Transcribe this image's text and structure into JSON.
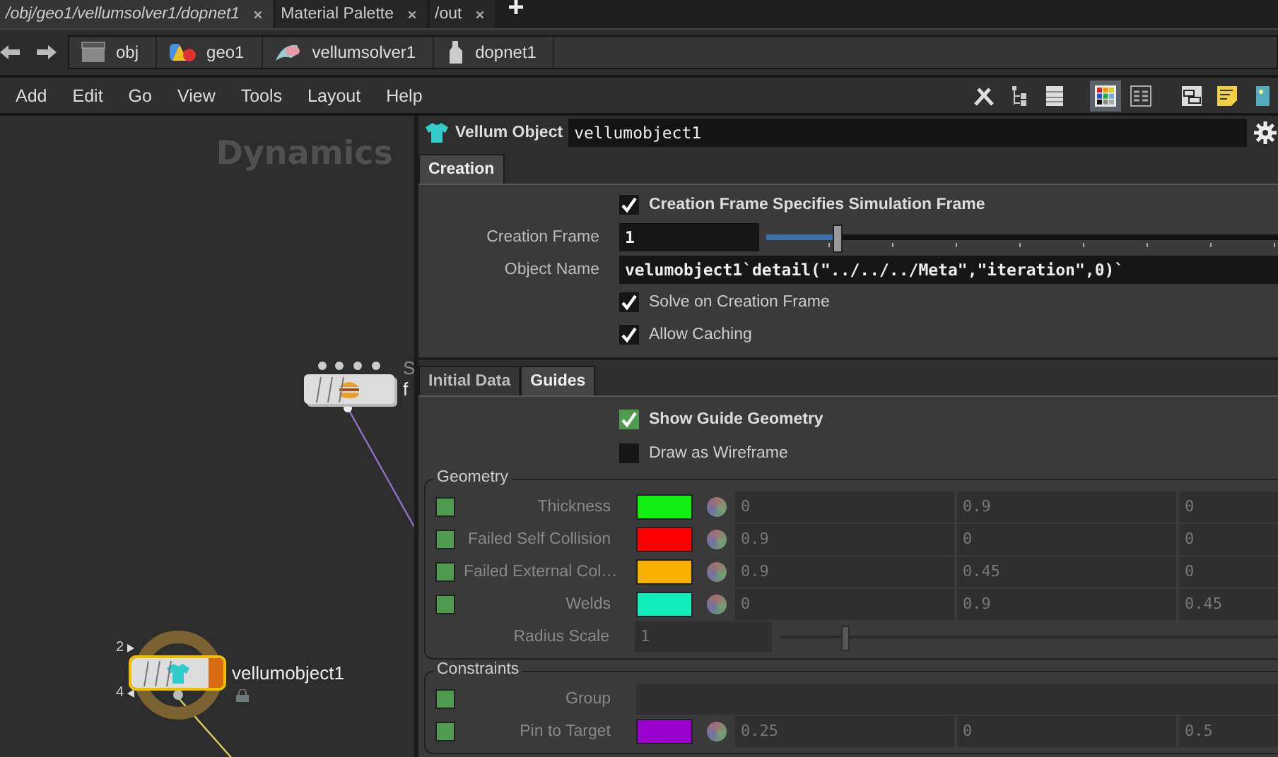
{
  "path_tabs": [
    {
      "label": "/obj/geo1/vellumsolver1/dopnet1",
      "selected": true
    },
    {
      "label": "Material Palette",
      "selected": false
    },
    {
      "label": "/out",
      "selected": false
    }
  ],
  "breadcrumbs": [
    {
      "label": "obj",
      "kind": "obj"
    },
    {
      "label": "geo1",
      "kind": "geo"
    },
    {
      "label": "vellumsolver1",
      "kind": "solver"
    },
    {
      "label": "dopnet1",
      "kind": "dopnet"
    }
  ],
  "menu": [
    "Add",
    "Edit",
    "Go",
    "View",
    "Tools",
    "Layout",
    "Help"
  ],
  "toolbar": [
    {
      "kind": "wrench",
      "selected": false
    },
    {
      "kind": "tree",
      "selected": false
    },
    {
      "kind": "list",
      "selected": false
    },
    {
      "kind": "palette",
      "selected": true
    },
    {
      "kind": "grid",
      "selected": false
    },
    {
      "kind": "boxes",
      "selected": false
    },
    {
      "kind": "note",
      "selected": false
    },
    {
      "kind": "image",
      "selected": false
    }
  ],
  "network": {
    "context_label": "Dynamics",
    "nodes": [
      {
        "kind": "force",
        "comment": "S",
        "label": "f",
        "selected": false,
        "locked": false
      },
      {
        "kind": "vellum",
        "label": "vellumobject1",
        "selected": true,
        "locked": true,
        "input_count": "2",
        "output_count": "4"
      }
    ]
  },
  "params": {
    "type_label": "Vellum Object",
    "name": "vellumobject1",
    "top_tabs": [
      {
        "label": "Creation",
        "selected": true
      }
    ],
    "creation": [
      {
        "kind": "toggle",
        "label": "Creation Frame Specifies Simulation Frame",
        "checked": true,
        "modified": true
      },
      {
        "kind": "slider",
        "label": "Creation Frame",
        "value": "1",
        "level": 0.13
      },
      {
        "kind": "text",
        "label": "Object Name",
        "value": "velumobject1`detail(\"../../../Meta\",\"iteration\",0)`"
      },
      {
        "kind": "toggle",
        "label": "Solve on Creation Frame",
        "checked": true,
        "modified": false
      },
      {
        "kind": "toggle",
        "label": "Allow Caching",
        "checked": true,
        "modified": false
      }
    ],
    "sub_tabs": [
      {
        "label": "Initial Data",
        "selected": false
      },
      {
        "label": "Guides",
        "selected": true
      }
    ],
    "guides": [
      {
        "label": "Show Guide Geometry",
        "checked": true,
        "modified": true
      },
      {
        "label": "Draw as Wireframe",
        "checked": false,
        "modified": false
      }
    ],
    "groups": [
      {
        "title": "Geometry",
        "rows": [
          {
            "kind": "color",
            "label": "Thickness",
            "enabled": true,
            "color": "#11ee11",
            "values": [
              "0",
              "0.9",
              "0"
            ]
          },
          {
            "kind": "color",
            "label": "Failed Self Collision",
            "enabled": true,
            "color": "#ff0000",
            "values": [
              "0.9",
              "0",
              "0"
            ]
          },
          {
            "kind": "color",
            "label": "Failed External Col…",
            "enabled": true,
            "color": "#f5b000",
            "values": [
              "0.9",
              "0.45",
              "0"
            ]
          },
          {
            "kind": "color",
            "label": "Welds",
            "enabled": true,
            "color": "#11eebb",
            "values": [
              "0",
              "0.9",
              "0.45"
            ]
          },
          {
            "kind": "slider",
            "label": "Radius Scale",
            "value": "1",
            "level": 0.12
          }
        ]
      },
      {
        "title": "Constraints",
        "rows": [
          {
            "kind": "group",
            "label": "Group",
            "enabled": true
          },
          {
            "kind": "color",
            "label": "Pin to Target",
            "enabled": true,
            "color": "#9900cc",
            "values": [
              "0.25",
              "0",
              "0.5"
            ]
          }
        ]
      }
    ]
  }
}
